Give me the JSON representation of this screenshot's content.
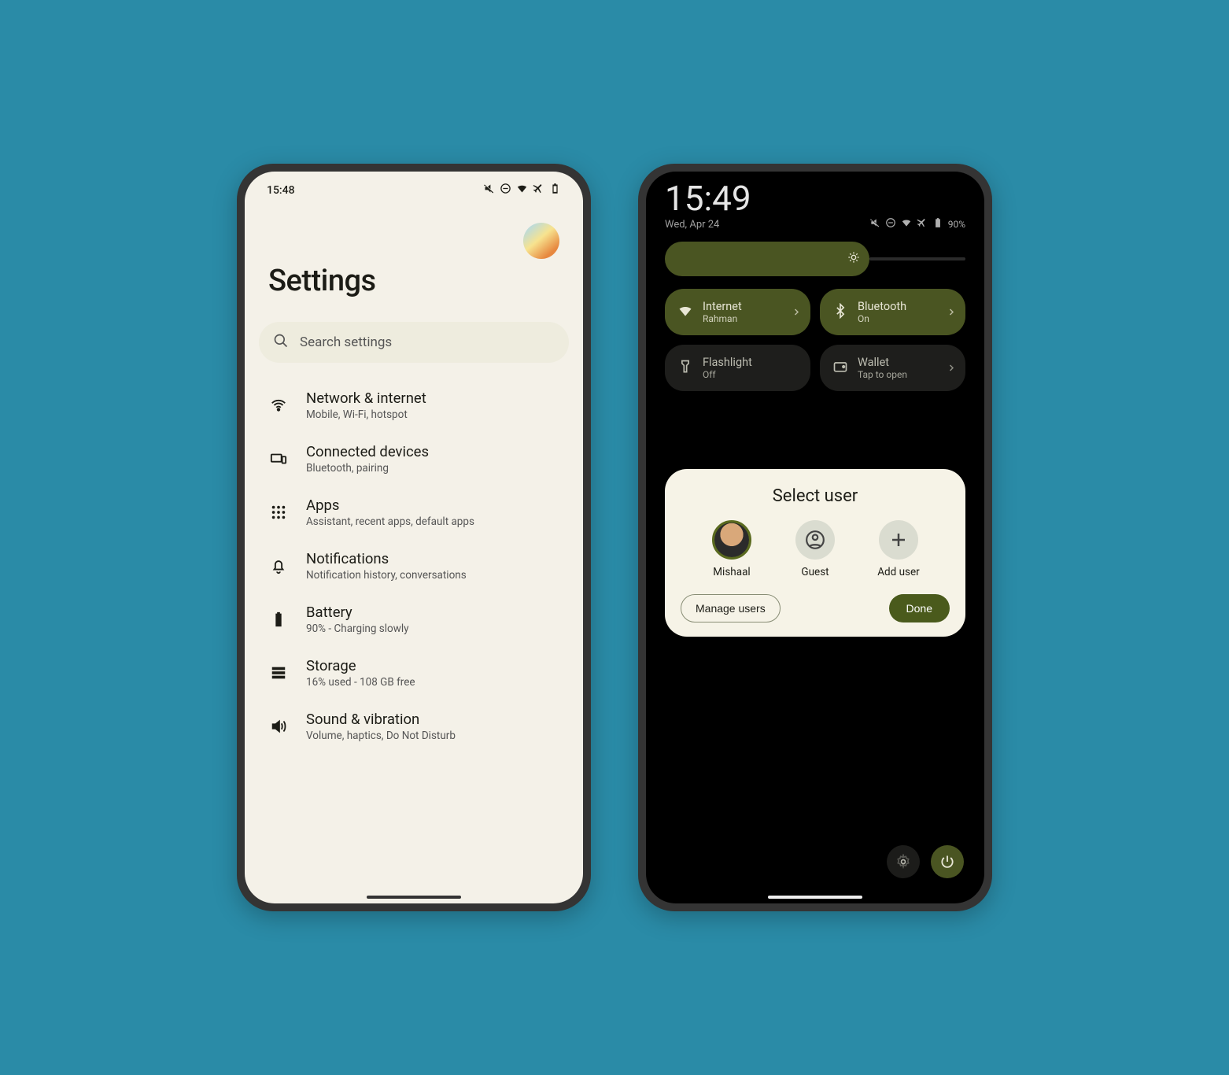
{
  "left": {
    "time": "15:48",
    "title": "Settings",
    "search_placeholder": "Search settings",
    "items": [
      {
        "title": "Network & internet",
        "sub": "Mobile, Wi-Fi, hotspot"
      },
      {
        "title": "Connected devices",
        "sub": "Bluetooth, pairing"
      },
      {
        "title": "Apps",
        "sub": "Assistant, recent apps, default apps"
      },
      {
        "title": "Notifications",
        "sub": "Notification history, conversations"
      },
      {
        "title": "Battery",
        "sub": "90% - Charging slowly"
      },
      {
        "title": "Storage",
        "sub": "16% used - 108 GB free"
      },
      {
        "title": "Sound & vibration",
        "sub": "Volume, haptics, Do Not Disturb"
      }
    ]
  },
  "right": {
    "time": "15:49",
    "date": "Wed, Apr 24",
    "battery_pct": "90%",
    "tiles": [
      {
        "title": "Internet",
        "sub": "Rahman",
        "on": true
      },
      {
        "title": "Bluetooth",
        "sub": "On",
        "on": true
      },
      {
        "title": "Flashlight",
        "sub": "Off",
        "on": false
      },
      {
        "title": "Wallet",
        "sub": "Tap to open",
        "on": false
      }
    ],
    "modal": {
      "title": "Select user",
      "users": [
        {
          "name": "Mishaal",
          "selected": true
        },
        {
          "name": "Guest",
          "selected": false
        },
        {
          "name": "Add user",
          "selected": false
        }
      ],
      "manage_label": "Manage users",
      "done_label": "Done"
    }
  }
}
